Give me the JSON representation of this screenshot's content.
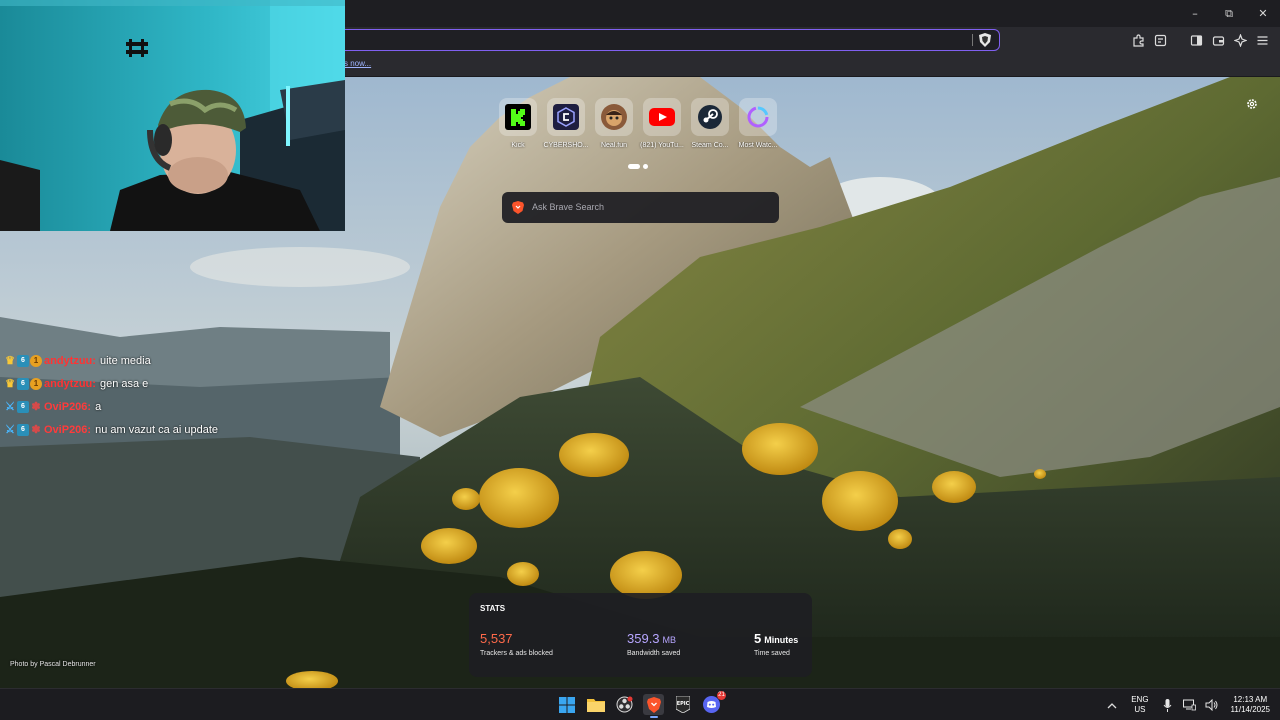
{
  "browser": {
    "bookmark_text": "s now...",
    "window_buttons": {
      "minimize": "–",
      "restore": "⧉",
      "close": "✕"
    },
    "toolbar_icons": [
      "extensions-icon",
      "page-icon",
      "sidebar-icon",
      "wallet-icon",
      "leo-ai-icon",
      "menu-icon"
    ]
  },
  "new_tab": {
    "top_sites": [
      {
        "label": "Kick",
        "color": "#53fc18",
        "icon": "kick-icon"
      },
      {
        "label": "CYBERSHO...",
        "color": "#2a2a6a",
        "icon": "cybershoke-icon"
      },
      {
        "label": "Neal.fun",
        "color": "#c8a870",
        "icon": "nealfun-icon"
      },
      {
        "label": "(821) YouTu...",
        "color": "#ff0000",
        "icon": "youtube-icon"
      },
      {
        "label": "Steam Co...",
        "color": "#1b2838",
        "icon": "steam-icon"
      },
      {
        "label": "Most Watc...",
        "color": "#b060ff",
        "icon": "loading-ring-icon"
      }
    ],
    "search_placeholder": "Ask Brave Search",
    "photo_credit": "Photo by Pascal Debrunner",
    "stats": {
      "title": "STATS",
      "trackers": {
        "value": "5,537",
        "label": "Trackers & ads blocked",
        "color": "#ff6a4a"
      },
      "bandwidth": {
        "value": "359.3",
        "unit": "MB",
        "label": "Bandwidth saved",
        "color": "#b7a6ff"
      },
      "time": {
        "value": "5",
        "unit": "Minutes",
        "label": "Time saved",
        "color": "#ffffff"
      }
    }
  },
  "chat": {
    "messages": [
      {
        "user": "andytzuu:",
        "text": "uite media",
        "color": "#ff3333",
        "badges": [
          "crown",
          "sub",
          "coin"
        ]
      },
      {
        "user": "andytzuu:",
        "text": "gen asa e",
        "color": "#ff3333",
        "badges": [
          "crown",
          "sub",
          "coin"
        ]
      },
      {
        "user": "OviP206:",
        "text": "a",
        "color": "#ff3b3b",
        "badges": [
          "sword",
          "sub",
          "gift"
        ]
      },
      {
        "user": "OviP206:",
        "text": "nu am vazut ca ai update",
        "color": "#ff3b3b",
        "badges": [
          "sword",
          "sub",
          "gift"
        ]
      }
    ]
  },
  "taskbar": {
    "apps": [
      "windows-start-icon",
      "file-explorer-icon",
      "obs-icon",
      "brave-icon",
      "epic-games-icon",
      "discord-icon"
    ],
    "discord_badge": "21",
    "lang_line1": "ENG",
    "lang_line2": "US",
    "time": "12:13 AM",
    "date": "11/14/2025"
  }
}
